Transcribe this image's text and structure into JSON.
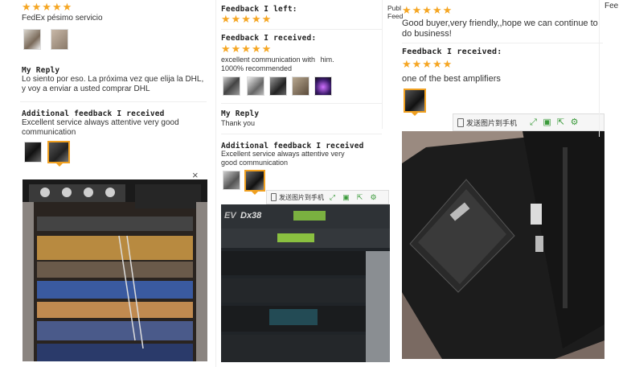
{
  "col1": {
    "stars": "★★★★★",
    "review_text": "FedEx pésimo servicio",
    "my_reply_label": "My Reply",
    "my_reply_text": "Lo siento por eso. La próxima vez que elija la DHL, y voy a enviar a usted comprar DHL",
    "additional_label": "Additional feedback I received",
    "additional_text": "Excellent service always attentive very good communication",
    "close_symbol": "×"
  },
  "col2": {
    "feedback_left_label": "Feedback I left:",
    "stars_left": "★★★★★",
    "feedback_received_label": "Feedback I received:",
    "stars_received": "★★★★★",
    "received_text": "excellent communication with",
    "received_text_handle": "him.",
    "received_text_tail": "1000% recommended",
    "my_reply_label": "My Reply",
    "my_reply_text": "Thank you",
    "additional_label": "Additional feedback I received",
    "additional_text": "Excellent service always attentive very good communication",
    "toolbar_send": "发送图片到手机",
    "photo_brand": "EV",
    "photo_model": "Dx38"
  },
  "col3": {
    "pub_label": "Publ",
    "feed_label": "Feed",
    "stars_top": "★★★★★",
    "top_text": "Good buyer,very friendly,,hope we can continue to do business!",
    "feedback_received_label": "Feedback I received:",
    "stars_received": "★★★★★",
    "received_text": "one of the best amplifiers",
    "toolbar_send": "发送图片到手机"
  },
  "col4": {
    "partial_label": "Fee"
  },
  "colors": {
    "star": "#f5a623",
    "selected_border": "#f0a020",
    "toolbar_icon": "#3a9a3a"
  }
}
